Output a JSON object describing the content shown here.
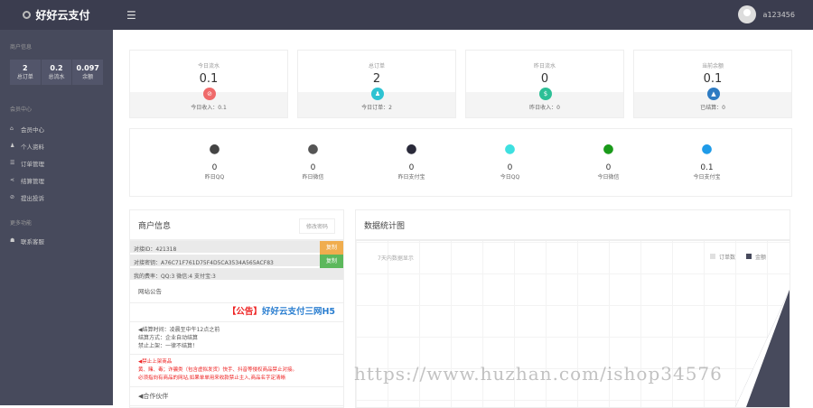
{
  "header": {
    "brand": "好好云支付",
    "menu_icon": "hamburger-icon",
    "username": "a123456"
  },
  "sidebar": {
    "section1": "商户信息",
    "stats": [
      {
        "value": "2",
        "label": "总订单"
      },
      {
        "value": "0.2",
        "label": "总流水"
      },
      {
        "value": "0.097",
        "label": "余额"
      }
    ],
    "section2": "会员中心",
    "items": [
      {
        "icon": "home-icon",
        "glyph": "⌂",
        "label": "会员中心"
      },
      {
        "icon": "user-icon",
        "glyph": "♟",
        "label": "个人资料"
      },
      {
        "icon": "list-icon",
        "glyph": "☰",
        "label": "订单管理"
      },
      {
        "icon": "share-icon",
        "glyph": "⋖",
        "label": "结算管理"
      },
      {
        "icon": "block-icon",
        "glyph": "⊘",
        "label": "提出投诉"
      }
    ],
    "section3": "更多功能",
    "items2": [
      {
        "icon": "contact-icon",
        "glyph": "☗",
        "label": "联系客服"
      }
    ]
  },
  "cards": [
    {
      "title": "今日流水",
      "value": "0.1",
      "foot": "今日收入：0.1",
      "color": "#ef6a6a",
      "glyph": "⊘"
    },
    {
      "title": "总订单",
      "value": "2",
      "foot": "今日订单：2",
      "color": "#2ec3d2",
      "glyph": "♟"
    },
    {
      "title": "昨日流水",
      "value": "0",
      "foot": "昨日收入：0",
      "color": "#2dbf96",
      "glyph": "$"
    },
    {
      "title": "当前余额",
      "value": "0.1",
      "foot": "已结算：0",
      "color": "#2e7bc2",
      "glyph": "▲"
    }
  ],
  "channels": [
    {
      "icon": "qq-icon",
      "glyph": "●",
      "color": "#444",
      "value": "0",
      "label": "昨日QQ"
    },
    {
      "icon": "wechat-icon",
      "glyph": "●",
      "color": "#555",
      "value": "0",
      "label": "昨日微信"
    },
    {
      "icon": "alipay-icon",
      "glyph": "●",
      "color": "#2a2a3a",
      "value": "0",
      "label": "昨日支付宝"
    },
    {
      "icon": "qq-icon",
      "glyph": "●",
      "color": "#3ee0e0",
      "value": "0",
      "label": "今日QQ"
    },
    {
      "icon": "wechat-icon",
      "glyph": "●",
      "color": "#1a9a1a",
      "value": "0",
      "label": "今日微信"
    },
    {
      "icon": "alipay-icon",
      "glyph": "●",
      "color": "#1f9be8",
      "value": "0.1",
      "label": "今日支付宝"
    }
  ],
  "merchant": {
    "title": "商户信息",
    "edit": "修改密码",
    "id_row": "对接ID：421318",
    "id_btn": "复制",
    "key_row": "对接密钥：A76C71F761D75F4D5CA3534A565ACF83",
    "key_btn": "复制",
    "rate_row": "我的费率：QQ:3 微信:4 支付宝:3",
    "notice_title": "网站公告",
    "banner_tag": "【公告】",
    "banner_text": "好好云支付三网H5",
    "settle": [
      "◀结算时间：凌晨至中午12点之前",
      "结算方式：企业自动结算",
      "禁止上架：一律不结算！"
    ],
    "ban": [
      "◀禁止上架商品",
      "黄、赌、毒；诈骗类（包含虚拟发货）快手、抖音等侵权商品禁止对接。",
      "必须指向有商品的网站,如果单单用来收款禁止主入,商品名字定清晰"
    ],
    "partner": "◀合作伙伴"
  },
  "chart": {
    "title": "数据统计图",
    "subtitle": "7天内数据显示",
    "legend": [
      {
        "label": "订单数",
        "color": "#e0e0e0"
      },
      {
        "label": "金额",
        "color": "#474a5c"
      }
    ]
  },
  "watermark": "https://www.huzhan.com/ishop34576"
}
